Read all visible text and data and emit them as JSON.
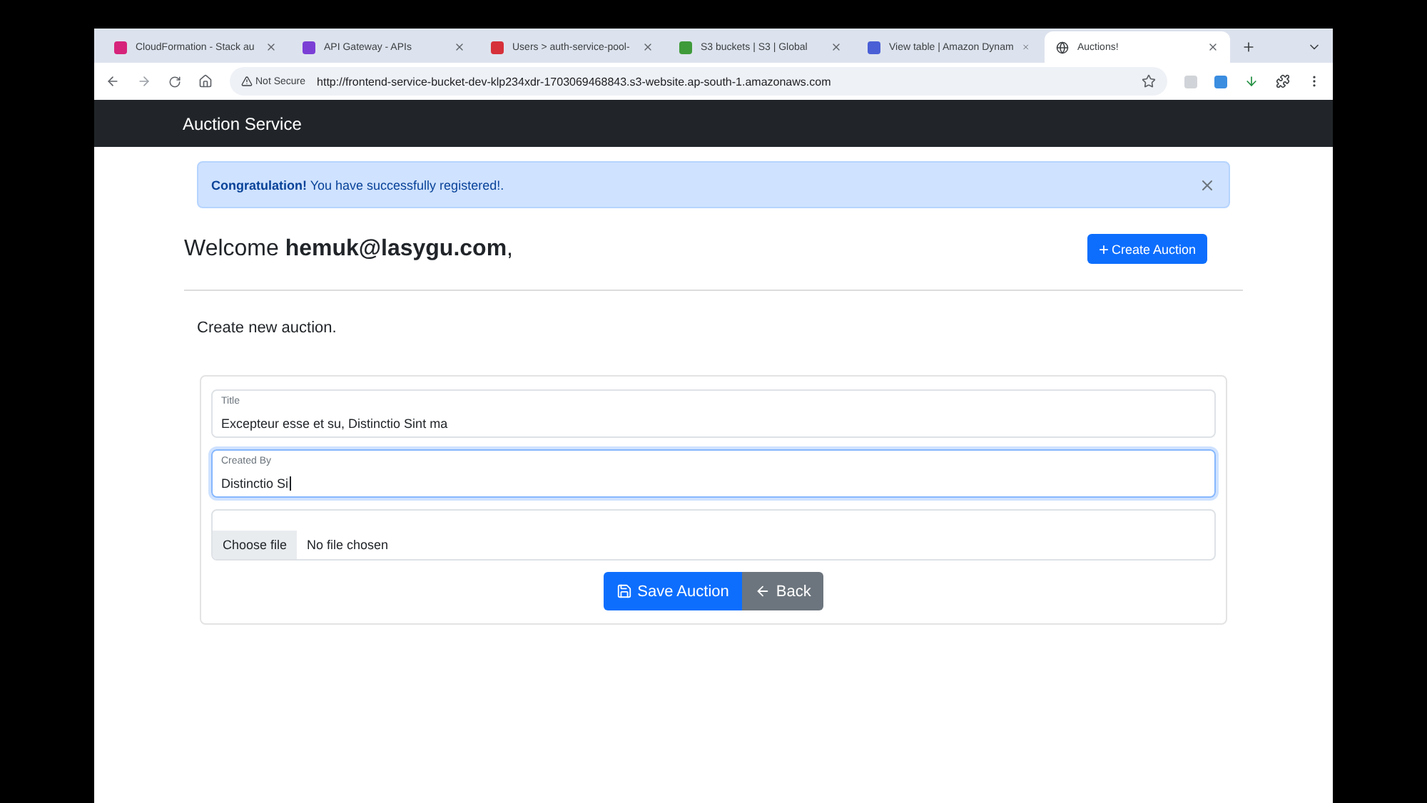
{
  "browser": {
    "tabs": [
      {
        "title": "CloudFormation - Stack au",
        "color": "#d6247a",
        "kind": "square",
        "selected": false
      },
      {
        "title": "API Gateway - APIs",
        "color": "#7b3fd6",
        "kind": "square",
        "selected": false
      },
      {
        "title": "Users > auth-service-pool-",
        "color": "#d6303a",
        "kind": "square",
        "selected": false
      },
      {
        "title": "S3 buckets | S3 | Global",
        "color": "#3f9a3a",
        "kind": "square",
        "selected": false
      },
      {
        "title": "View table | Amazon Dynam",
        "color": "#4a5fd6",
        "kind": "square",
        "selected": false
      },
      {
        "title": "Auctions!",
        "color": "#3c4043",
        "kind": "globe",
        "selected": true
      }
    ],
    "security": "Not Secure",
    "url": "http://frontend-service-bucket-dev-klp234xdr-1703069468843.s3-website.ap-south-1.amazonaws.com"
  },
  "navbar": {
    "brand": "Auction Service"
  },
  "alert": {
    "text": "**Congratulation!** You have successfully registered!."
  },
  "welcome": {
    "text": "Welcome **hemuk@lasygu.com**,"
  },
  "create_button": {
    "icon": "+",
    "label": "Create Auction"
  },
  "section_title": "Create new auction.",
  "form": {
    "fields": [
      {
        "label": "Title",
        "value": "Excepteur esse et su, Distinctio Sint ma",
        "focused": false
      },
      {
        "label": "Created By",
        "value": "Distinctio Si",
        "focused": true
      }
    ],
    "file": {
      "button": "Choose file",
      "status": "No file chosen"
    },
    "save_button": "Save Auction",
    "back_button": "Back"
  }
}
